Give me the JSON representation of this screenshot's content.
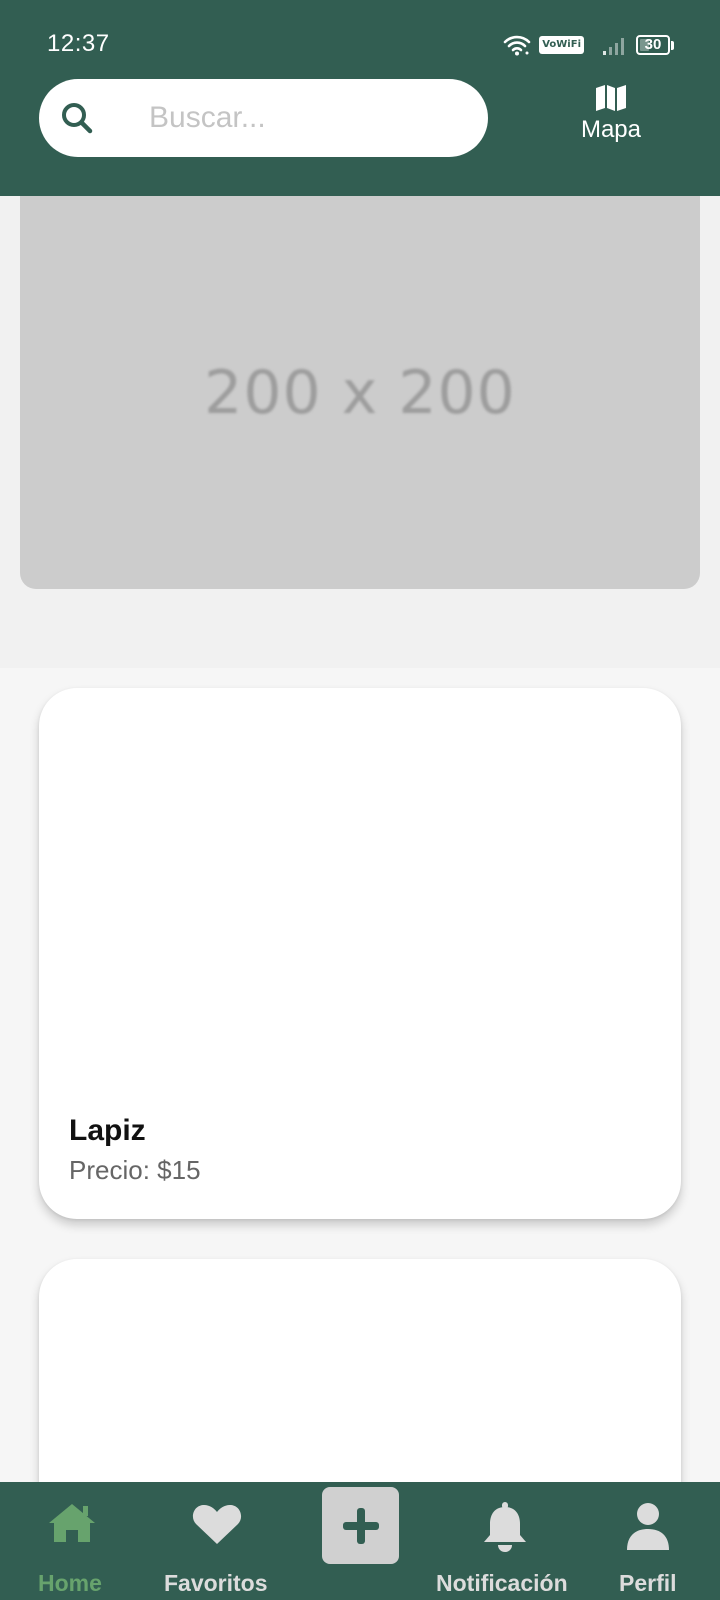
{
  "status_bar": {
    "time": "12:37",
    "vowifi_label": "VoWiFi",
    "battery_level": "30"
  },
  "header": {
    "search": {
      "placeholder": "Buscar..."
    },
    "map_label": "Mapa"
  },
  "banner": {
    "placeholder_text": "200 x 200"
  },
  "products": [
    {
      "name": "Lapiz",
      "price_label": "Precio: $15"
    }
  ],
  "bottom_nav": {
    "items": [
      {
        "label": "Home",
        "icon": "home-icon",
        "active": true
      },
      {
        "label": "Favoritos",
        "icon": "heart-icon",
        "active": false
      },
      {
        "label": "",
        "icon": "plus-icon",
        "active": false
      },
      {
        "label": "Notificación",
        "icon": "bell-icon",
        "active": false
      },
      {
        "label": "Perfil",
        "icon": "user-icon",
        "active": false
      }
    ]
  },
  "colors": {
    "header_bg": "#325e52",
    "active_nav": "#67a36d",
    "inactive_nav": "#dcdcdc"
  }
}
